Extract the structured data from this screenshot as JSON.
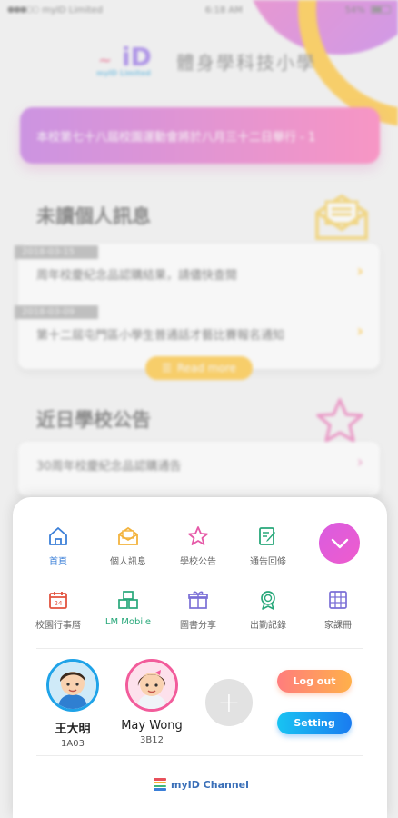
{
  "status_bar": {
    "carrier": "myID Limited",
    "time": "6:18 AM",
    "battery": "54%"
  },
  "header": {
    "logo_text": "myID",
    "logo_sub": "Limited",
    "school_name": "體身學科技小學"
  },
  "marquee": {
    "text": "本校第七十八屆校園運動會將於八月三十二日舉行 - 1"
  },
  "messages": {
    "title": "未讀個人訊息",
    "items": [
      {
        "date": "2018-03-15",
        "text": "周年校慶紀念品認購結果，請儘快查閱"
      },
      {
        "date": "2018-03-09",
        "text": "第十二屆屯門區小學生普通話才藝比賽報名通知"
      }
    ],
    "read_more": "Read more"
  },
  "notices": {
    "title": "近日學校公告",
    "items": [
      {
        "text": "30周年校慶紀念品認購通告"
      }
    ]
  },
  "menu": {
    "row1": [
      {
        "label": "首頁",
        "icon": "home-icon",
        "color": "#3b7fd8"
      },
      {
        "label": "個人訊息",
        "icon": "envelope-icon",
        "color": "#f3b33d"
      },
      {
        "label": "學校公告",
        "icon": "star-icon",
        "color": "#e65aa8"
      },
      {
        "label": "通告回條",
        "icon": "edit-document-icon",
        "color": "#28a87a"
      }
    ],
    "row2": [
      {
        "label": "校園行事曆",
        "icon": "calendar-icon",
        "color": "#e2533f"
      },
      {
        "label": "LM Mobile",
        "icon": "boxes-icon",
        "color": "#28a87a"
      },
      {
        "label": "圖書分享",
        "icon": "gift-icon",
        "color": "#7b6fd6"
      },
      {
        "label": "出勤記錄",
        "icon": "medal-icon",
        "color": "#28a87a"
      },
      {
        "label": "家課冊",
        "icon": "grid-book-icon",
        "color": "#7b6fd6"
      }
    ]
  },
  "accounts": [
    {
      "name": "王大明",
      "class": "1A03",
      "active": true
    },
    {
      "name": "May Wong",
      "class": "3B12",
      "active": false
    }
  ],
  "buttons": {
    "logout": "Log out",
    "setting": "Setting",
    "add": "+"
  },
  "footer": {
    "channel": "myID Channel"
  },
  "colors": {
    "accent_pink": "#e45fd0",
    "accent_orange": "#ffb400",
    "logout_gradient": "#ff7d7d",
    "setting_gradient": "#1a9cf2"
  }
}
